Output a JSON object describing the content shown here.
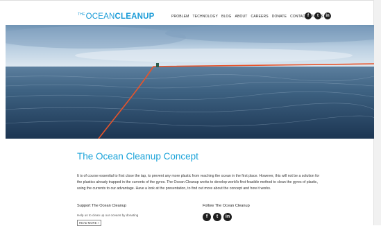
{
  "header": {
    "logo_the": "THE",
    "logo_ocean": "OCEAN",
    "logo_cleanup": "CLEANUP",
    "nav": [
      "PROBLEM",
      "TECHNOLOGY",
      "BLOG",
      "ABOUT",
      "CAREERS",
      "DONATE",
      "CONTACT",
      "PRESS"
    ],
    "social": [
      {
        "icon": "facebook-icon",
        "glyph": "f"
      },
      {
        "icon": "twitter-icon",
        "glyph": "t"
      },
      {
        "icon": "linkedin-icon",
        "glyph": "in"
      }
    ]
  },
  "main": {
    "title": "The Ocean Cleanup Concept",
    "intro": "It is of course essential to first close the tap, to prevent any more plastic from reaching the ocean in the first place. However, this will not be a solution for the plastics already trapped in the currents of the gyres. The Ocean Cleanup works to develop world's first feasible method to clean the gyres of plastic, using the currents to our advantage. Have a look at the presentation, to find out more about the concept and how it works."
  },
  "support": {
    "heading": "Support The Ocean Cleanup",
    "text": "Help us to clean up our oceans by donating",
    "button": "READ MORE »"
  },
  "follow": {
    "heading": "Follow The Ocean Cleanup",
    "social": [
      {
        "icon": "facebook-icon",
        "glyph": "f"
      },
      {
        "icon": "twitter-icon",
        "glyph": "t"
      },
      {
        "icon": "linkedin-icon",
        "glyph": "in"
      }
    ]
  },
  "colors": {
    "brand": "#1a9bd7",
    "title": "#1aa3d9",
    "boom": "#e8542a",
    "social_bg": "#1f1f1f"
  }
}
